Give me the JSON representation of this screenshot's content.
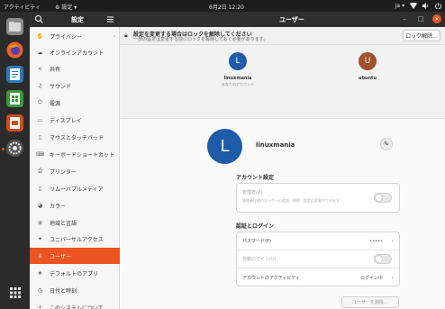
{
  "topbar": {
    "activities": "アクティビティ",
    "app_menu": "⚙ 設定 ▾",
    "clock": "6月2日 12:20",
    "input_method": "ja ▾",
    "tray_icons": [
      "network-icon",
      "volume-icon",
      "power-icon"
    ]
  },
  "dock": {
    "apps": [
      {
        "name": "files",
        "color": "#8a8a8a"
      },
      {
        "name": "firefox",
        "color": "#e8622b"
      },
      {
        "name": "writer",
        "color": "#2a7ab8"
      },
      {
        "name": "calc",
        "color": "#3a9b3a"
      },
      {
        "name": "impress",
        "color": "#d24d1d"
      },
      {
        "name": "settings",
        "color": "#555555"
      }
    ],
    "show_apps_icon": "grid-icon"
  },
  "window": {
    "sidebar_title": "設定",
    "main_title": "ユーザー"
  },
  "sidebar": {
    "items": [
      {
        "label": "プライバシー",
        "icon": "hand-icon",
        "glyph": "✋",
        "chevron": true
      },
      {
        "label": "オンラインアカウント",
        "icon": "cloud-icon",
        "glyph": "☁"
      },
      {
        "label": "共有",
        "icon": "share-icon",
        "glyph": "<"
      },
      {
        "label": "サウンド",
        "icon": "music-icon",
        "glyph": "♫"
      },
      {
        "label": "電源",
        "icon": "power-icon",
        "glyph": "⏻"
      },
      {
        "label": "ディスプレイ",
        "icon": "display-icon",
        "glyph": "▭"
      },
      {
        "label": "マウスとタッチパッド",
        "icon": "mouse-icon",
        "glyph": "▯"
      },
      {
        "label": "キーボードショートカット",
        "icon": "keyboard-icon",
        "glyph": "⌨"
      },
      {
        "label": "プリンター",
        "icon": "printer-icon",
        "glyph": "⎙"
      },
      {
        "label": "リムーバブルメディア",
        "icon": "media-icon",
        "glyph": "▯"
      },
      {
        "label": "カラー",
        "icon": "color-icon",
        "glyph": "◕"
      },
      {
        "label": "地域と言語",
        "icon": "globe-icon",
        "glyph": "⊕"
      },
      {
        "label": "ユニバーサルアクセス",
        "icon": "accessibility-icon",
        "glyph": "✦"
      },
      {
        "label": "ユーザー",
        "icon": "user-icon",
        "glyph": "♙",
        "selected": true
      },
      {
        "label": "デフォルトのアプリ",
        "icon": "star-icon",
        "glyph": "★"
      },
      {
        "label": "日付と時刻",
        "icon": "clock-icon",
        "glyph": "◷"
      },
      {
        "label": "このシステムについて",
        "icon": "plus-icon",
        "glyph": "+"
      }
    ]
  },
  "banner": {
    "title": "設定を変更する場合はロックを解除してください",
    "subtitle": "一部の設定は変更する前にロックを解除しておく必要があります。",
    "unlock_label": "ロック解除..."
  },
  "users": [
    {
      "initial": "L",
      "name": "linuxmania",
      "sub": "あなたのアカウント",
      "color": "#1e5ba8"
    },
    {
      "initial": "U",
      "name": "ubuntu",
      "sub": "",
      "color": "#a0522d"
    }
  ],
  "profile": {
    "initial": "L",
    "name": "linuxmania",
    "avatar_color": "#1e5ba8"
  },
  "account_settings": {
    "title": "アカウント設定",
    "admin_label": "管理者(A)",
    "admin_desc": "管理者は他のユーザーの追加、削除、設定の変更ができます。"
  },
  "auth": {
    "title": "認証とログイン",
    "password_label": "パスワード(P)",
    "password_value": "•••••",
    "autologin_label": "自動ログイン(U)",
    "activity_label": "アカウントのアクティビティ",
    "activity_value": "ログイン中"
  },
  "remove_user_label": "ユーザーを削除..."
}
